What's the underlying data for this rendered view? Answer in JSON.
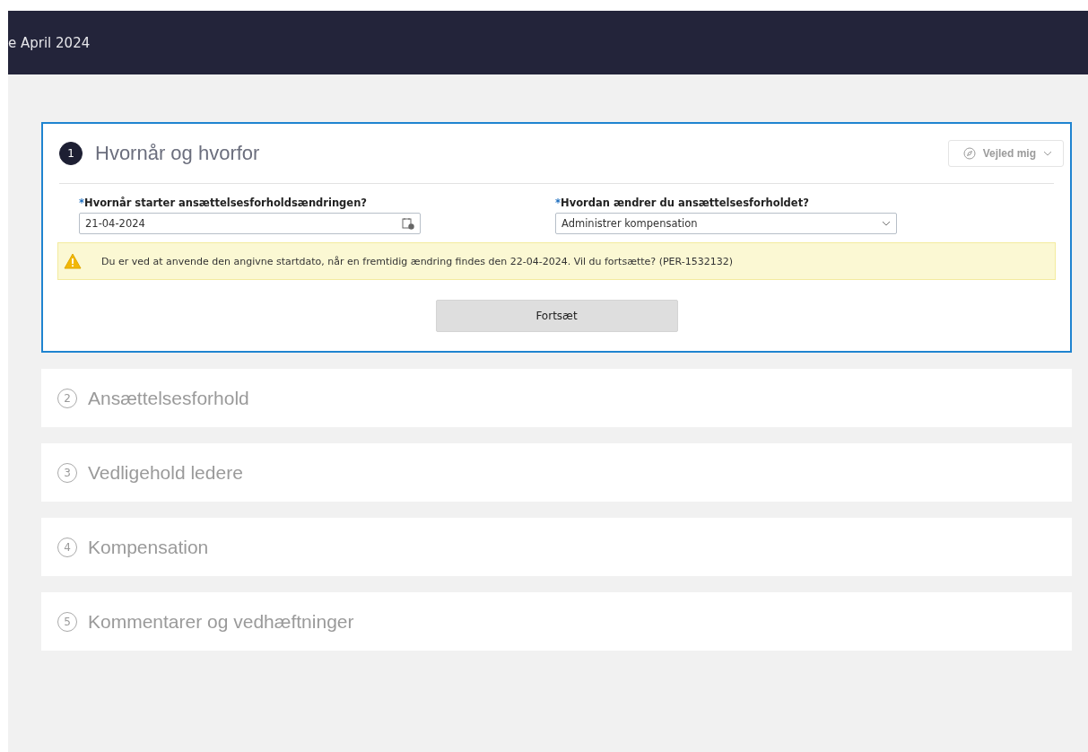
{
  "header": {
    "title": "e April 2024"
  },
  "steps": [
    {
      "number": "1",
      "title": "Hvornår og hvorfor",
      "active": true
    },
    {
      "number": "2",
      "title": "Ansættelsesforhold",
      "active": false
    },
    {
      "number": "3",
      "title": "Vedligehold ledere",
      "active": false
    },
    {
      "number": "4",
      "title": "Kompensation",
      "active": false
    },
    {
      "number": "5",
      "title": "Kommentarer og vedhæftninger",
      "active": false
    }
  ],
  "guide_button": {
    "label": "Vejled mig",
    "disabled": true
  },
  "fields": [
    {
      "kind": "date",
      "required_mark": "*",
      "label": "Hvornår starter ansættelsesforholdsændringen?",
      "value": "21-04-2024"
    },
    {
      "kind": "select",
      "required_mark": "*",
      "label": "Hvordan ændrer du ansættelsesforholdet?",
      "value": "Administrer kompensation"
    }
  ],
  "warning": {
    "text": "Du er ved at anvende den angivne startdato, når en fremtidig ændring findes den 22-04-2024. Vil du fortsætte? (PER-1532132)"
  },
  "continue_button": {
    "label": "Fortsæt"
  }
}
